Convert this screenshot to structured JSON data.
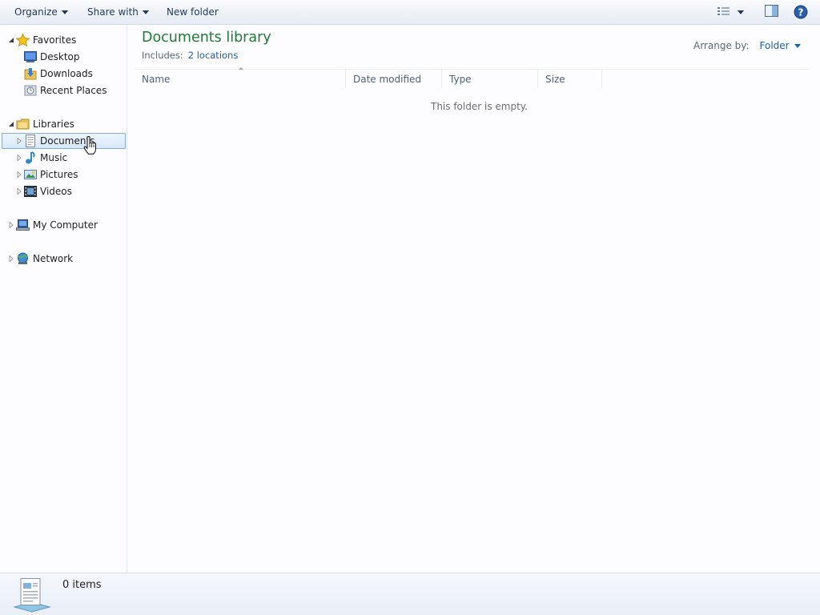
{
  "toolbar": {
    "organize": "Organize",
    "share_with": "Share with",
    "new_folder": "New folder"
  },
  "nav": {
    "favorites": "Favorites",
    "favorites_items": [
      "Desktop",
      "Downloads",
      "Recent Places"
    ],
    "libraries": "Libraries",
    "libraries_items": [
      "Documents",
      "Music",
      "Pictures",
      "Videos"
    ],
    "my_computer": "My Computer",
    "network": "Network"
  },
  "main": {
    "title": "Documents library",
    "includes_label": "Includes:",
    "includes_link": "2 locations",
    "arrange_label": "Arrange by:",
    "arrange_value": "Folder",
    "columns": [
      "Name",
      "Date modified",
      "Type",
      "Size"
    ],
    "empty_message": "This folder is empty."
  },
  "status": {
    "item_count": "0 items"
  },
  "colors": {
    "title_green": "#1e7a34",
    "link_blue": "#1e5eb0",
    "selection_border": "#84acdd"
  }
}
